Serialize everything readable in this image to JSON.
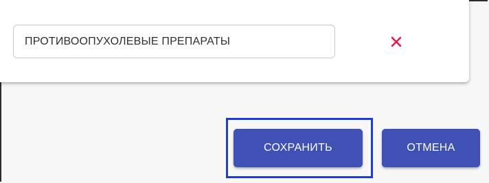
{
  "tag_field": {
    "value": "ПРОТИВООПУХОЛЕВЫЕ ПРЕПАРАТЫ"
  },
  "actions": {
    "save_label": "СОХРАНИТЬ",
    "cancel_label": "ОТМЕНА"
  },
  "colors": {
    "primary": "#3f51b5",
    "delete": "#e8174a",
    "focus_ring": "#1f3bdc"
  },
  "icons": {
    "delete": "close-icon"
  }
}
